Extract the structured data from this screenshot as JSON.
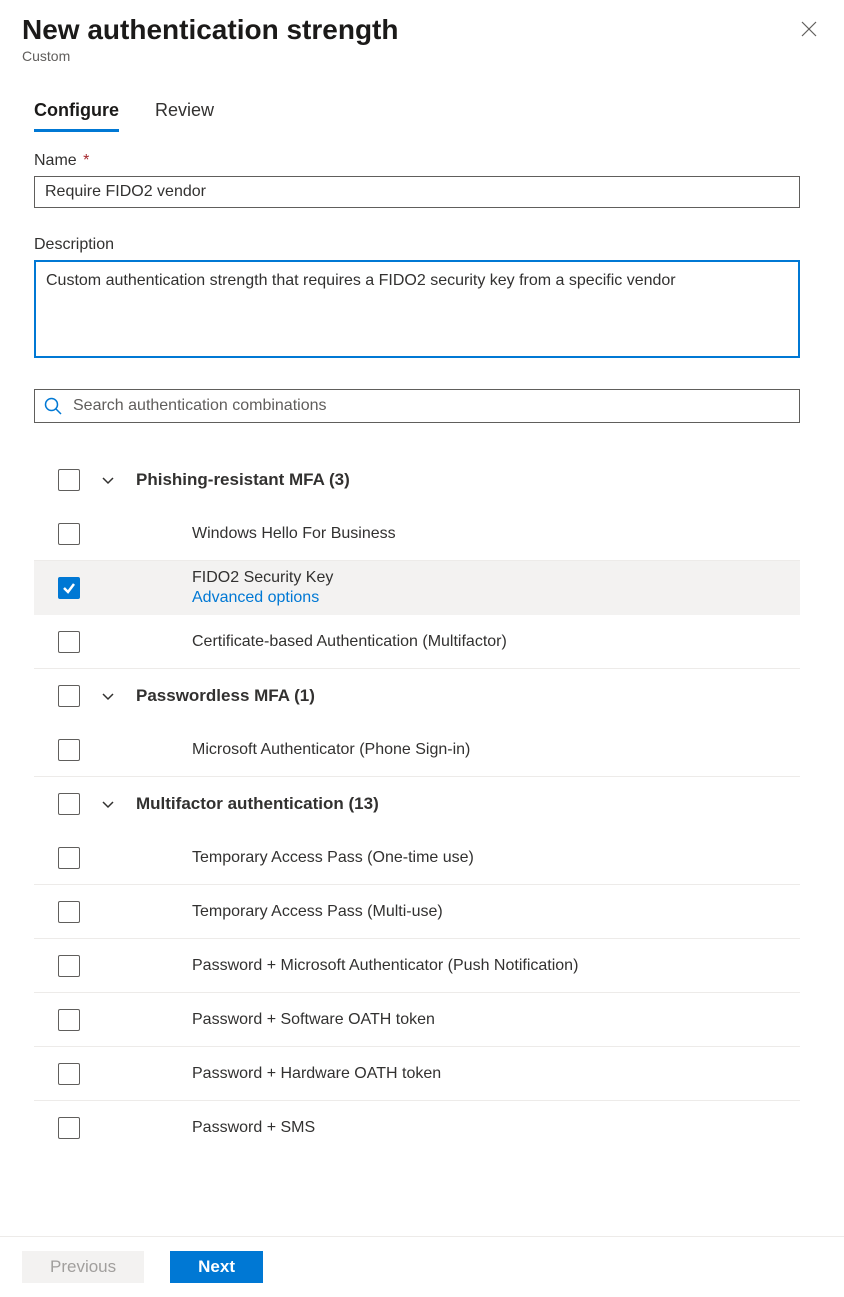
{
  "header": {
    "title": "New authentication strength",
    "subtitle": "Custom"
  },
  "tabs": {
    "configure": "Configure",
    "review": "Review"
  },
  "form": {
    "name_label": "Name",
    "name_value": "Require FIDO2 vendor",
    "description_label": "Description",
    "description_value": "Custom authentication strength that requires a FIDO2 security key from a specific vendor"
  },
  "search": {
    "placeholder": "Search authentication combinations"
  },
  "groups": [
    {
      "label": "Phishing-resistant MFA (3)",
      "items": [
        {
          "label": "Windows Hello For Business",
          "checked": false
        },
        {
          "label": "FIDO2 Security Key",
          "checked": true,
          "selected": true,
          "sublink": "Advanced options"
        },
        {
          "label": "Certificate-based Authentication (Multifactor)",
          "checked": false
        }
      ]
    },
    {
      "label": "Passwordless MFA (1)",
      "items": [
        {
          "label": "Microsoft Authenticator (Phone Sign-in)",
          "checked": false
        }
      ]
    },
    {
      "label": "Multifactor authentication (13)",
      "items": [
        {
          "label": "Temporary Access Pass (One-time use)",
          "checked": false
        },
        {
          "label": "Temporary Access Pass (Multi-use)",
          "checked": false
        },
        {
          "label": "Password + Microsoft Authenticator (Push Notification)",
          "checked": false
        },
        {
          "label": "Password + Software OATH token",
          "checked": false
        },
        {
          "label": "Password + Hardware OATH token",
          "checked": false
        },
        {
          "label": "Password + SMS",
          "checked": false
        }
      ]
    }
  ],
  "footer": {
    "previous": "Previous",
    "next": "Next"
  }
}
